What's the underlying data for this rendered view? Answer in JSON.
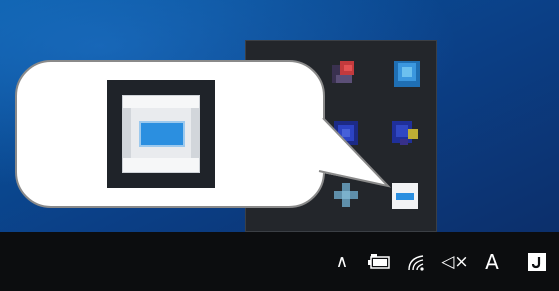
{
  "desktop": {
    "wallpaper_color": "#0b4a92"
  },
  "tray_overflow": {
    "background": "#23262b",
    "icons": [
      {
        "name": "red-app-icon",
        "color": "#d9413f"
      },
      {
        "name": "blue-app-icon",
        "color": "#2f8ad8"
      },
      {
        "name": "dark-blue-app-icon",
        "color": "#2a3fb8"
      },
      {
        "name": "yellow-blue-app-icon",
        "color": "#c9b733"
      },
      {
        "name": "teal-plus-app-icon",
        "color": "#5a92b2"
      },
      {
        "name": "window-app-icon",
        "color": "#2b8fe0"
      }
    ]
  },
  "callout": {
    "magnified_icon": "window-app-icon"
  },
  "taskbar": {
    "show_hidden_icons_glyph": "∧",
    "battery_icon": "battery-icon",
    "network_icon": "wifi-icon",
    "volume_glyph": "◁×",
    "ime_label": "A",
    "clock_icon": "notification-icon"
  }
}
